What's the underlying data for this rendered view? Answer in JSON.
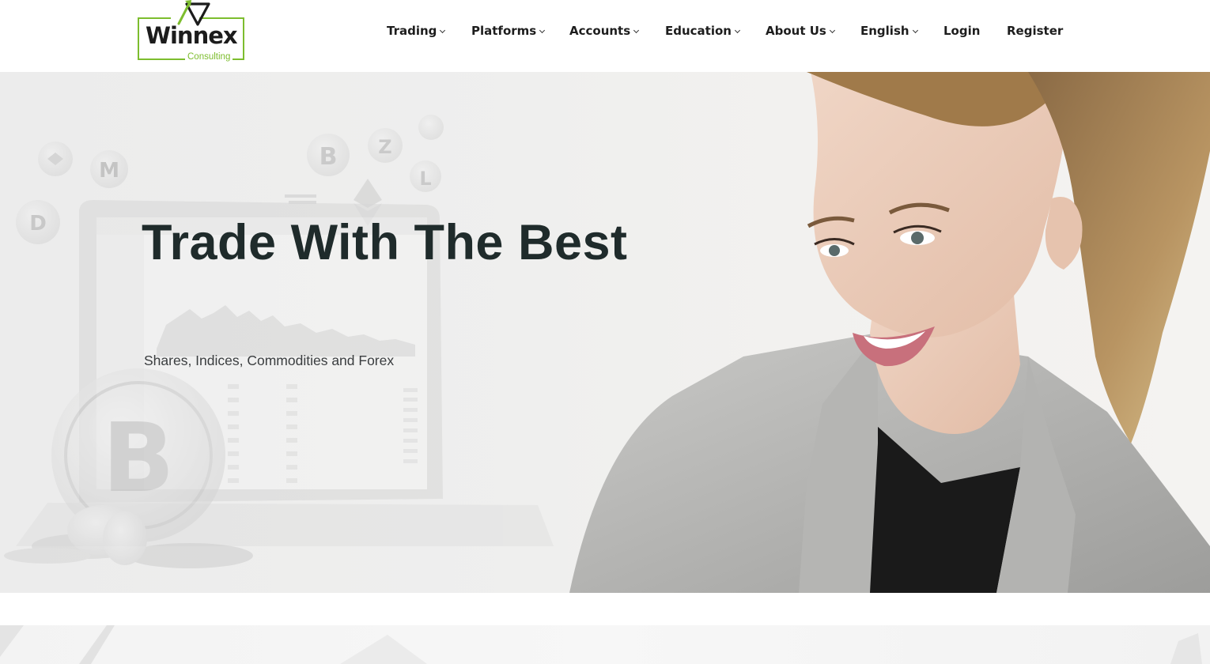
{
  "brand": {
    "name": "Winnex",
    "tagline": "Consulting",
    "accent_color": "#7dbd2e"
  },
  "nav": {
    "items": [
      {
        "label": "Trading",
        "has_dropdown": true
      },
      {
        "label": "Platforms",
        "has_dropdown": true
      },
      {
        "label": "Accounts",
        "has_dropdown": true
      },
      {
        "label": "Education",
        "has_dropdown": true
      },
      {
        "label": "About Us",
        "has_dropdown": true
      },
      {
        "label": "English",
        "has_dropdown": true
      },
      {
        "label": "Login",
        "has_dropdown": false
      },
      {
        "label": "Register",
        "has_dropdown": false
      }
    ]
  },
  "hero": {
    "title": "Trade With The Best",
    "subtitle": "Shares, Indices, Commodities and Forex",
    "title_color": "#1f2b2b"
  }
}
